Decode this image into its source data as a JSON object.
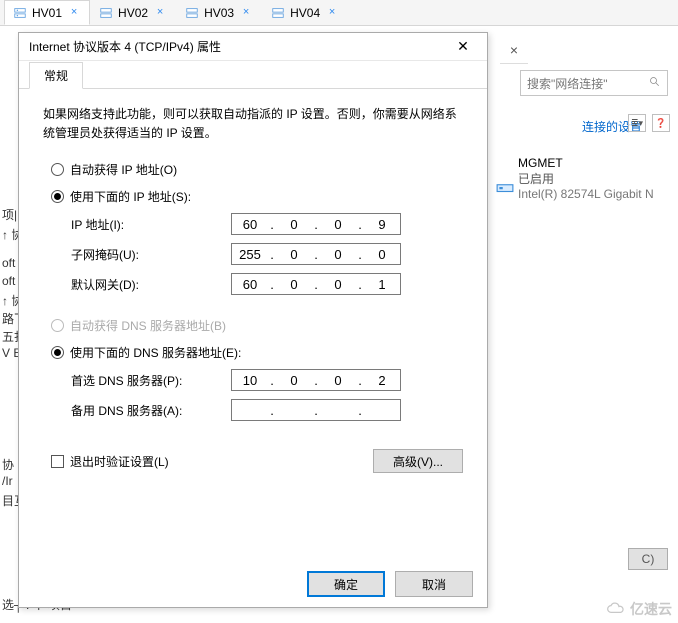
{
  "tabs": [
    {
      "label": "HV01"
    },
    {
      "label": "HV02"
    },
    {
      "label": "HV03"
    },
    {
      "label": "HV04"
    }
  ],
  "panel_close_hint": "×",
  "background": {
    "search_placeholder": "搜索\"网络连接\"",
    "link_settings": "连接的设置",
    "adapter": {
      "name": "MGMET",
      "status": "已启用",
      "hardware": "Intel(R) 82574L Gigabit N"
    },
    "button_c": "C)",
    "left_bits": {
      "l1": "项|",
      "l2": "↑ 协",
      "l3": "oft",
      "l4": "oft",
      "l5": "↑ 协",
      "l6": "路飞",
      "l7": "五扑",
      "l8": "V E",
      "l9": "协",
      "l10": "/Ir",
      "l11": "目互",
      "l12": "选┬ Ⅰ 丨 坝目"
    }
  },
  "dialog": {
    "title": "Internet 协议版本 4 (TCP/IPv4) 属性",
    "tab_general": "常规",
    "intro": "如果网络支持此功能，则可以获取自动指派的 IP 设置。否则，你需要从网络系统管理员处获得适当的 IP 设置。",
    "radio_auto_ip": "自动获得 IP 地址(O)",
    "radio_manual_ip": "使用下面的 IP 地址(S):",
    "label_ip": "IP 地址(I):",
    "label_mask": "子网掩码(U):",
    "label_gateway": "默认网关(D):",
    "ip": {
      "a": "60",
      "b": "0",
      "c": "0",
      "d": "9"
    },
    "mask": {
      "a": "255",
      "b": "0",
      "c": "0",
      "d": "0"
    },
    "gw": {
      "a": "60",
      "b": "0",
      "c": "0",
      "d": "1"
    },
    "radio_auto_dns": "自动获得 DNS 服务器地址(B)",
    "radio_manual_dns": "使用下面的 DNS 服务器地址(E):",
    "label_dns1": "首选 DNS 服务器(P):",
    "label_dns2": "备用 DNS 服务器(A):",
    "dns1": {
      "a": "10",
      "b": "0",
      "c": "0",
      "d": "2"
    },
    "dns2": {
      "a": "",
      "b": "",
      "c": "",
      "d": ""
    },
    "check_validate": "退出时验证设置(L)",
    "btn_advanced": "高级(V)...",
    "btn_ok": "确定",
    "btn_cancel": "取消"
  },
  "watermark": "亿速云"
}
